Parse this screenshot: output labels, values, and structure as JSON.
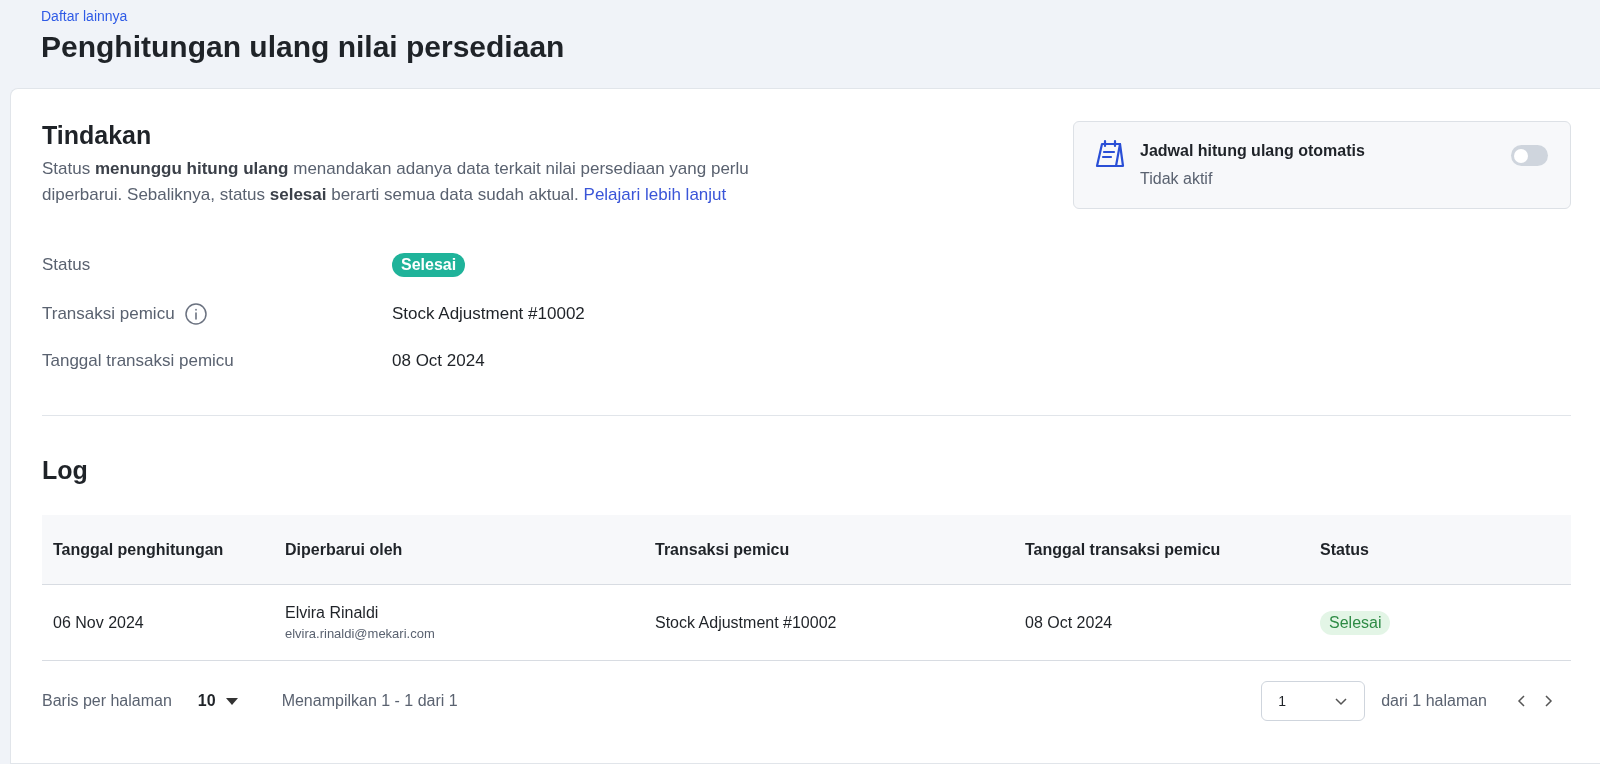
{
  "breadcrumb": "Daftar lainnya",
  "title": "Penghitungan ulang nilai persediaan",
  "actions": {
    "heading": "Tindakan",
    "description": "Status **menunggu hitung ulang** menandakan adanya data terkait nilai persediaan yang perlu diperbarui. Sebaliknya, status **selesai** berarti semua data sudah aktual.",
    "link": "Pelajari lebih lanjut",
    "fields": [
      {
        "label": "Status",
        "kind": "badge",
        "value": "Selesai",
        "info": false
      },
      {
        "label": "Transaksi pemicu",
        "kind": "text",
        "value": "Stock Adjustment #10002",
        "info": true
      },
      {
        "label": "Tanggal transaksi pemicu",
        "kind": "text",
        "value": "08 Oct 2024",
        "info": false
      }
    ]
  },
  "schedule": {
    "title": "Jadwal hitung ulang otomatis",
    "subtitle": "Tidak aktif",
    "on": false
  },
  "log": {
    "heading": "Log",
    "columns": [
      "Tanggal penghitungan",
      "Diperbarui oleh",
      "Transaksi pemicu",
      "Tanggal transaksi pemicu",
      "Status"
    ],
    "rows": [
      {
        "date": "06 Nov 2024",
        "user": "Elvira Rinaldi",
        "email": "elvira.rinaldi@mekari.com",
        "transaction": "Stock Adjustment #10002",
        "transaction_date": "08 Oct 2024",
        "status": "Selesai"
      }
    ]
  },
  "pagination": {
    "rows_label": "Baris per halaman",
    "rows_value": "10",
    "showing": "Menampilkan 1 - 1 dari 1",
    "page": "1",
    "pages_label": "dari 1 halaman"
  }
}
